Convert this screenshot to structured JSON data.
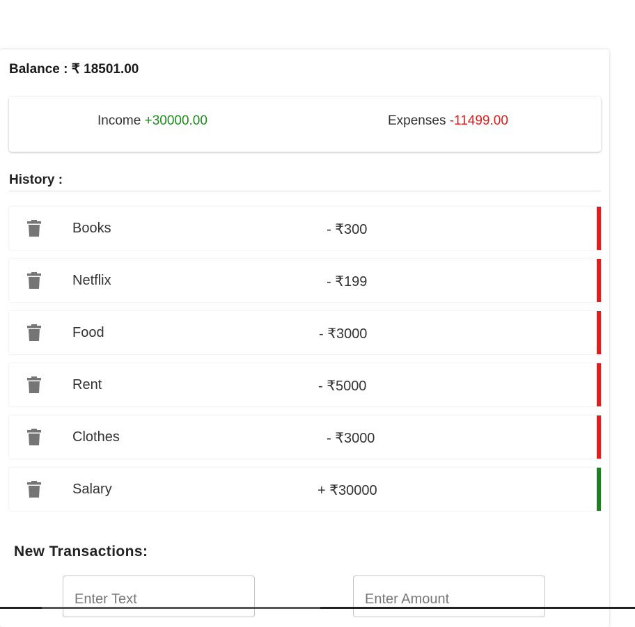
{
  "balance": {
    "label": "Balance : ₹ 18501.00"
  },
  "summary": {
    "income_label": "Income ",
    "income_value": "+30000.00",
    "expense_label": "Expenses ",
    "expense_value": "-11499.00"
  },
  "history": {
    "title": "History :",
    "items": [
      {
        "label": "Books",
        "amount": "- ₹300",
        "type": "expense"
      },
      {
        "label": "Netflix",
        "amount": "- ₹199",
        "type": "expense"
      },
      {
        "label": "Food",
        "amount": "- ₹3000",
        "type": "expense"
      },
      {
        "label": "Rent",
        "amount": "- ₹5000",
        "type": "expense"
      },
      {
        "label": "Clothes",
        "amount": "- ₹3000",
        "type": "expense"
      },
      {
        "label": "Salary",
        "amount": "+ ₹30000",
        "type": "income"
      }
    ]
  },
  "new_transaction": {
    "title": "New Transactions:",
    "text_placeholder": "Enter Text",
    "amount_placeholder": "Enter Amount"
  },
  "colors": {
    "income": "#1e8a1e",
    "expense": "#e11b1b",
    "icon": "#757575"
  },
  "icons": {
    "delete": "trash-icon"
  }
}
